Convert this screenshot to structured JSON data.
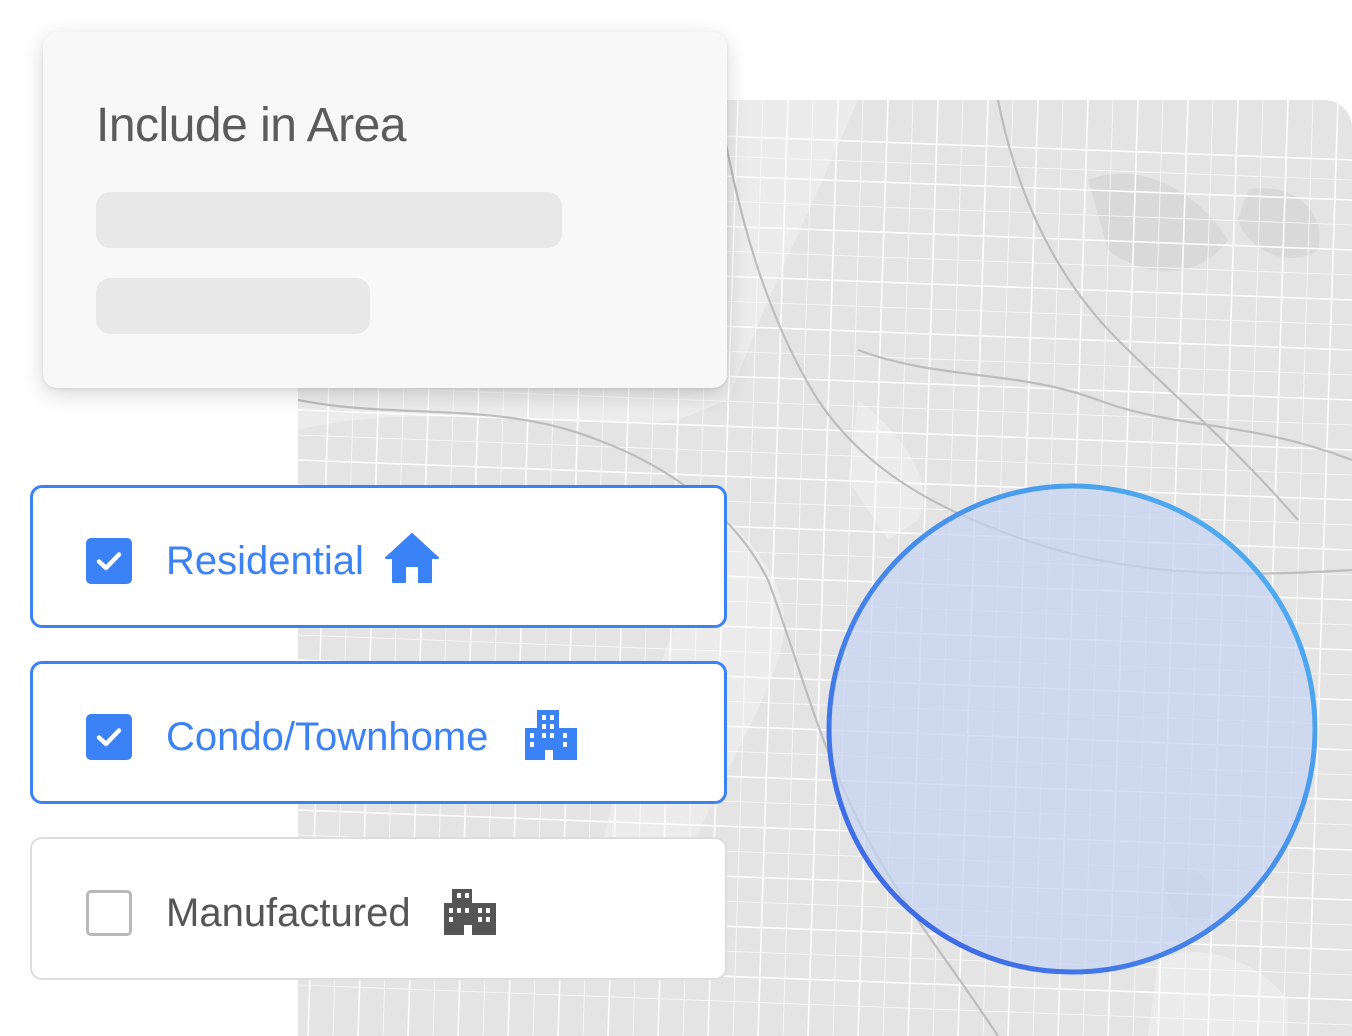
{
  "area_card": {
    "title": "Include in Area"
  },
  "property_types": [
    {
      "label": "Residential",
      "checked": true,
      "icon": "house-icon"
    },
    {
      "label": "Condo/Townhome",
      "checked": true,
      "icon": "building-icon"
    },
    {
      "label": "Manufactured",
      "checked": false,
      "icon": "building-icon"
    }
  ],
  "colors": {
    "accent": "#3b82f6",
    "map_background": "#e4e4e4",
    "map_roads": "#ffffff",
    "selection_fill": "#c9d6f2",
    "selection_stroke_start": "#3f6fe6",
    "selection_stroke_end": "#4fb2f0",
    "unchecked_text": "#555555"
  }
}
